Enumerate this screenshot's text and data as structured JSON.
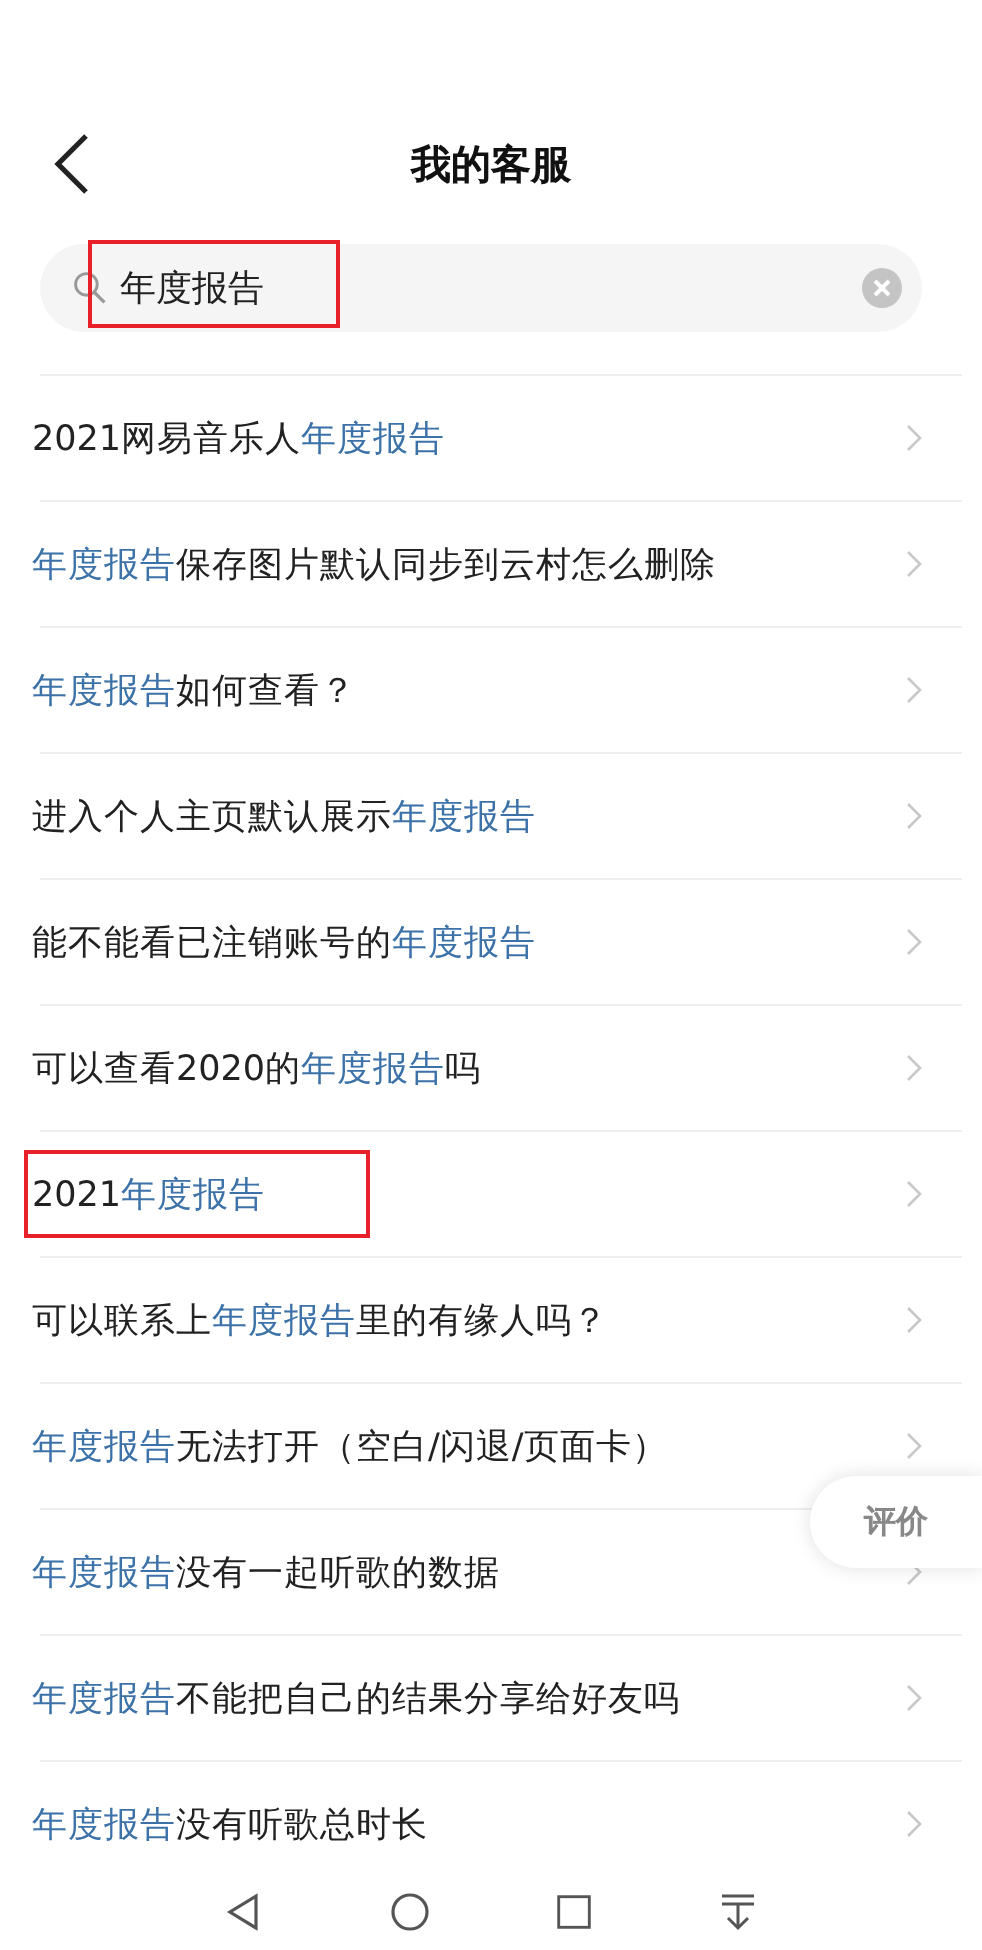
{
  "header": {
    "title": "我的客服"
  },
  "search": {
    "value": "年度报告",
    "highlighted": true
  },
  "results": [
    {
      "parts": [
        {
          "text": "2021网易音乐人",
          "match": false
        },
        {
          "text": "年度报告",
          "match": true
        }
      ],
      "highlighted": false
    },
    {
      "parts": [
        {
          "text": "年度报告",
          "match": true
        },
        {
          "text": "保存图片默认同步到云村怎么删除",
          "match": false
        }
      ],
      "highlighted": false
    },
    {
      "parts": [
        {
          "text": "年度报告",
          "match": true
        },
        {
          "text": "如何查看？",
          "match": false
        }
      ],
      "highlighted": false
    },
    {
      "parts": [
        {
          "text": "进入个人主页默认展示",
          "match": false
        },
        {
          "text": "年度报告",
          "match": true
        }
      ],
      "highlighted": false
    },
    {
      "parts": [
        {
          "text": "能不能看已注销账号的",
          "match": false
        },
        {
          "text": "年度报告",
          "match": true
        }
      ],
      "highlighted": false
    },
    {
      "parts": [
        {
          "text": "可以查看2020的",
          "match": false
        },
        {
          "text": "年度报告",
          "match": true
        },
        {
          "text": "吗",
          "match": false
        }
      ],
      "highlighted": false
    },
    {
      "parts": [
        {
          "text": "2021",
          "match": false
        },
        {
          "text": "年度报告",
          "match": true
        }
      ],
      "highlighted": true
    },
    {
      "parts": [
        {
          "text": "可以联系上",
          "match": false
        },
        {
          "text": "年度报告",
          "match": true
        },
        {
          "text": "里的有缘人吗？",
          "match": false
        }
      ],
      "highlighted": false
    },
    {
      "parts": [
        {
          "text": "年度报告",
          "match": true
        },
        {
          "text": "无法打开（空白/闪退/页面卡）",
          "match": false
        }
      ],
      "highlighted": false
    },
    {
      "parts": [
        {
          "text": "年度报告",
          "match": true
        },
        {
          "text": "没有一起听歌的数据",
          "match": false
        }
      ],
      "highlighted": false
    },
    {
      "parts": [
        {
          "text": "年度报告",
          "match": true
        },
        {
          "text": "不能把自己的结果分享给好友吗",
          "match": false
        }
      ],
      "highlighted": false
    },
    {
      "parts": [
        {
          "text": "年度报告",
          "match": true
        },
        {
          "text": "没有听歌总时长",
          "match": false
        }
      ],
      "highlighted": false
    }
  ],
  "rate_button": {
    "label": "评价"
  }
}
